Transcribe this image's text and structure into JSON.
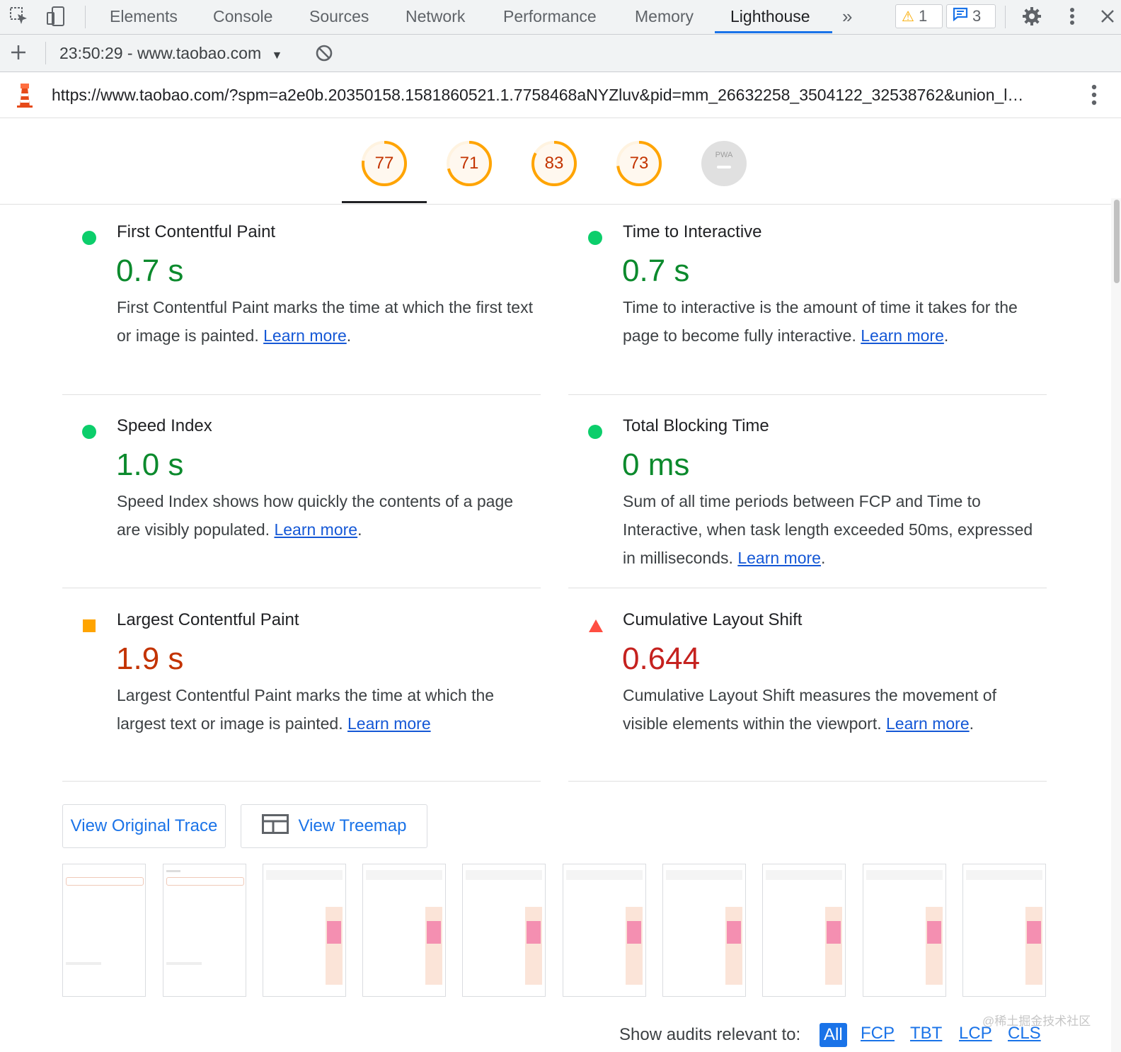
{
  "devtools": {
    "tabs": [
      {
        "label": "Elements"
      },
      {
        "label": "Console"
      },
      {
        "label": "Sources"
      },
      {
        "label": "Network"
      },
      {
        "label": "Performance"
      },
      {
        "label": "Memory"
      },
      {
        "label": "Lighthouse",
        "active": true
      }
    ],
    "overflow_icon": "double-chevron-right-icon",
    "warnings_count": "1",
    "messages_count": "3",
    "icons": [
      "inspect-element-icon",
      "device-toolbar-icon",
      "gear-icon",
      "kebab-menu-icon",
      "close-icon"
    ]
  },
  "report_bar": {
    "report_label": "23:50:29 - www.taobao.com",
    "icons": [
      "plus-icon",
      "dropdown-arrow-icon",
      "clear-icon"
    ]
  },
  "url_bar": {
    "url": "https://www.taobao.com/?spm=a2e0b.20350158.1581860521.1.7758468aNYZluv&pid=mm_26632258_3504122_32538762&union_l…",
    "icons": [
      "lighthouse-logo-icon",
      "kebab-menu-icon"
    ]
  },
  "gauges": [
    {
      "value": "77",
      "score": 0.77,
      "color": "#ffa400"
    },
    {
      "value": "71",
      "score": 0.71,
      "color": "#ffa400"
    },
    {
      "value": "83",
      "score": 0.83,
      "color": "#ffa400"
    },
    {
      "value": "73",
      "score": 0.73,
      "color": "#ffa400"
    },
    {
      "value": "PWA",
      "type": "pwa"
    }
  ],
  "metrics": [
    {
      "title": "First Contentful Paint",
      "value": "0.7 s",
      "status": "pass",
      "desc": "First Contentful Paint marks the time at which the first text or image is painted. ",
      "link": "Learn more",
      "end": "."
    },
    {
      "title": "Time to Interactive",
      "value": "0.7 s",
      "status": "pass",
      "desc": "Time to interactive is the amount of time it takes for the page to become fully interactive. ",
      "link": "Learn more",
      "end": "."
    },
    {
      "title": "Speed Index",
      "value": "1.0 s",
      "status": "pass",
      "desc": "Speed Index shows how quickly the contents of a page are visibly populated. ",
      "link": "Learn more",
      "end": "."
    },
    {
      "title": "Total Blocking Time",
      "value": "0 ms",
      "status": "pass",
      "desc": "Sum of all time periods between FCP and Time to Interactive, when task length exceeded 50ms, expressed in milliseconds. ",
      "link": "Learn more",
      "end": "."
    },
    {
      "title": "Largest Contentful Paint",
      "value": "1.9 s",
      "status": "average",
      "desc": "Largest Contentful Paint marks the time at which the largest text or image is painted. ",
      "link": "Learn more",
      "end": ""
    },
    {
      "title": "Cumulative Layout Shift",
      "value": "0.644",
      "status": "fail",
      "desc": "Cumulative Layout Shift measures the movement of visible elements within the viewport. ",
      "link": "Learn more",
      "end": "."
    }
  ],
  "status_colors": {
    "pass": "#0cce6b",
    "average": "#ffa400",
    "fail": "#ff4e42"
  },
  "buttons": {
    "view_trace": "View Original Trace",
    "view_treemap": "View Treemap"
  },
  "audit_filter": {
    "label": "Show audits relevant to:",
    "options": [
      "All",
      "FCP",
      "TBT",
      "LCP",
      "CLS"
    ],
    "selected": "All"
  },
  "watermark": "@稀土掘金技术社区"
}
